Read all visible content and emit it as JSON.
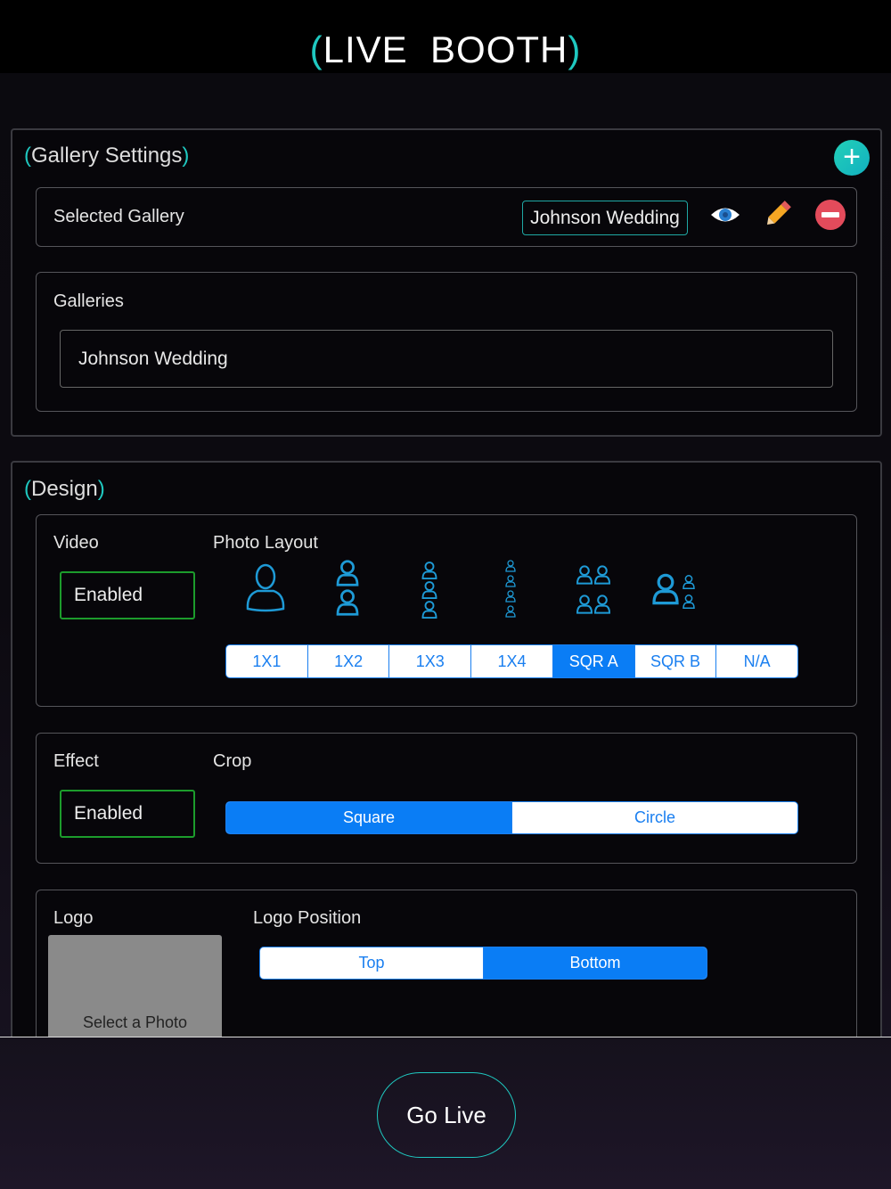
{
  "header": {
    "title": "LIVE  BOOTH",
    "paren_open": "(",
    "paren_close": ")"
  },
  "gallery_settings": {
    "title": "Gallery Settings",
    "selected_label": "Selected Gallery",
    "selected_value": "Johnson Wedding",
    "galleries_label": "Galleries",
    "galleries": [
      "Johnson Wedding"
    ]
  },
  "design": {
    "title": "Design",
    "video_label": "Video",
    "video_value": "Enabled",
    "photo_layout_label": "Photo Layout",
    "layouts": [
      "1X1",
      "1X2",
      "1X3",
      "1X4",
      "SQR A",
      "SQR B",
      "N/A"
    ],
    "selected_layout": "SQR A",
    "effect_label": "Effect",
    "effect_value": "Enabled",
    "crop_label": "Crop",
    "crop_options": [
      "Square",
      "Circle"
    ],
    "selected_crop": "Square",
    "logo_label": "Logo",
    "logo_placeholder": "Select a Photo",
    "logo_position_label": "Logo Position",
    "logo_positions": [
      "Top",
      "Bottom"
    ],
    "selected_logo_position": "Bottom"
  },
  "footer": {
    "go_live": "Go Live"
  },
  "colors": {
    "accent": "#1fc8c0",
    "segment_blue": "#0a7df5",
    "enabled_green": "#1c9c2c"
  }
}
